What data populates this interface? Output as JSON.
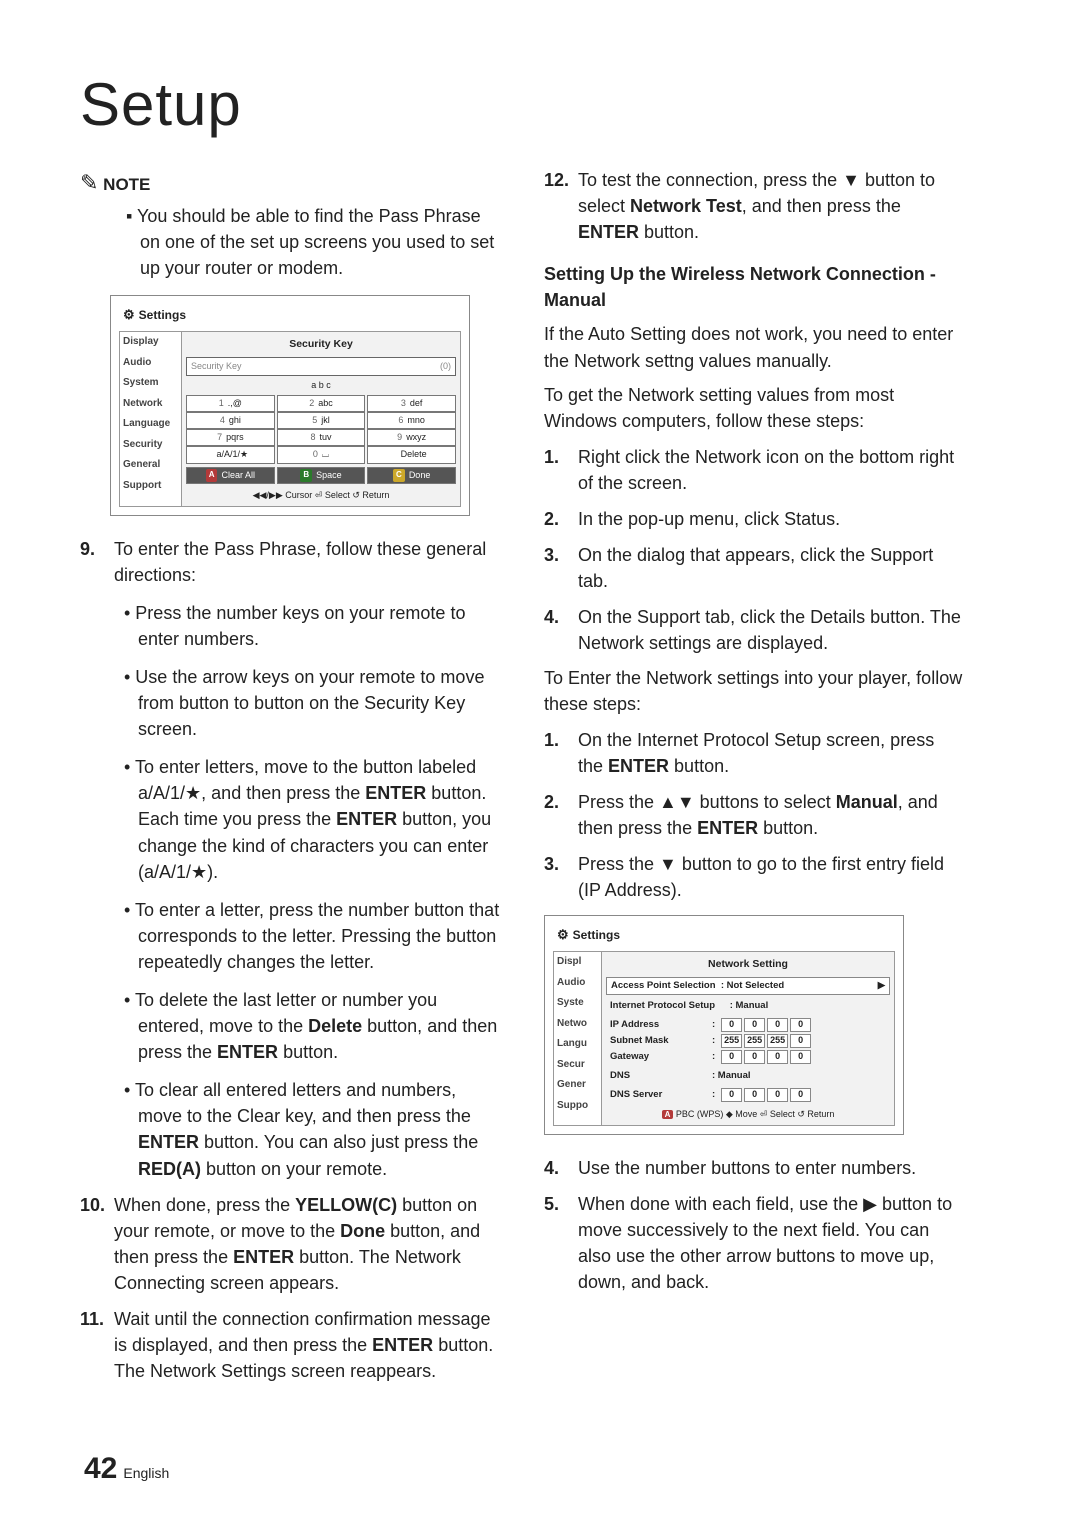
{
  "title": "Setup",
  "noteLabel": "NOTE",
  "noteBody": "▪ You should be able to find the Pass Phrase on one of the set up screens you used to set up your router or modem.",
  "shot1": {
    "settingsLabel": "Settings",
    "sidebar": [
      "Display",
      "Audio",
      "System",
      "Network",
      "Language",
      "Security",
      "General",
      "Support"
    ],
    "paneTitle": "Security Key",
    "inputPlaceholder": "Security Key",
    "inputCount": "(0)",
    "abc": "a  b  c",
    "keys": [
      [
        "1",
        ".,@",
        "2",
        "abc",
        "3",
        "def"
      ],
      [
        "4",
        "ghi",
        "5",
        "jkl",
        "6",
        "mno"
      ],
      [
        "7",
        "pqrs",
        "8",
        "tuv",
        "9",
        "wxyz"
      ],
      [
        "",
        "a/A/1/★",
        "0",
        "⌴",
        "",
        "Delete"
      ]
    ],
    "bottom": {
      "clear": "Clear All",
      "space": "Space",
      "done": "Done"
    },
    "hints": "◀◀/▶▶ Cursor   ⏎ Select   ↺ Return"
  },
  "left": {
    "step9": {
      "num": "9.",
      "text": "To enter the Pass Phrase, follow these general directions:"
    },
    "b1": "• Press the number keys on your remote to enter numbers.",
    "b2": "• Use the arrow keys on your remote to move from button to button on the Security Key screen.",
    "b3_pre": "• To enter letters, move to the button labeled a/A/1/★, and then press the ",
    "b3_mid": " button. Each time you press the ",
    "b3_post": " button, you change the kind of characters you can enter (a/A/1/★).",
    "b4": "• To enter a letter, press the number button that corresponds to the letter. Pressing the button repeatedly changes the letter.",
    "b5_pre": "• To delete the last letter or number you entered, move to the ",
    "b5_mid": " button, and then press the ",
    "b5_post": " button.",
    "b6_pre": "• To clear all entered letters and numbers, move to the Clear key, and then press the ",
    "b6_mid": " button. You can also just press the ",
    "b6_post": " button on your remote.",
    "step10": {
      "num": "10.",
      "pre": "When done, press the ",
      "mid": " button on your remote, or move to the ",
      "mid2": " button, and then press the ",
      "post": " button. The Network Connecting screen appears."
    },
    "step11": {
      "num": "11.",
      "pre": "Wait until the connection confirmation message is displayed, and then press the ",
      "post": " button. The Network Settings screen reappears."
    }
  },
  "right": {
    "step12": {
      "num": "12.",
      "pre": "To test the connection, press the ▼ button to select ",
      "mid": ", and then press the ",
      "post": " button."
    },
    "subhead": "Setting Up the Wireless Network Connection - Manual",
    "p1": "If the Auto Setting does not work, you need to enter the Network settng values manually.",
    "p2": "To get the Network setting values from most Windows computers, follow these steps:",
    "s1": {
      "num": "1.",
      "text": "Right click the Network icon on the bottom right of the screen."
    },
    "s2": {
      "num": "2.",
      "text": "In the pop-up menu, click Status."
    },
    "s3": {
      "num": "3.",
      "text": "On the dialog that appears, click the Support tab."
    },
    "s4": {
      "num": "4.",
      "text": "On the Support tab, click the Details button. The Network settings are displayed."
    },
    "p3": "To Enter the Network settings into your player, follow these steps:",
    "t1": {
      "num": "1.",
      "pre": "On the Internet Protocol Setup screen, press the ",
      "post": " button."
    },
    "t2": {
      "num": "2.",
      "pre": "Press the ▲▼ buttons to select ",
      "mid": ", and then press the ",
      "post": " button."
    },
    "t3": {
      "num": "3.",
      "text": "Press the ▼ button to go to the first entry field (IP Address)."
    },
    "u4": {
      "num": "4.",
      "text": "Use the number buttons to enter numbers."
    },
    "u5": {
      "num": "5.",
      "text": "When done with each field, use the ▶ button to move successively to the next field. You can also use the other arrow buttons to move up, down, and back."
    }
  },
  "shot2": {
    "settingsLabel": "Settings",
    "sidebar": [
      "Display",
      "Audio",
      "System",
      "Network",
      "Language",
      "Security",
      "General",
      "Support"
    ],
    "paneTitle": "Network Setting",
    "ap": {
      "label": "Access Point Selection",
      "value": ": Not Selected"
    },
    "ips": {
      "label": "Internet Protocol Setup",
      "value": ": Manual"
    },
    "rows": [
      {
        "label": "IP Address",
        "vals": [
          "0",
          "0",
          "0",
          "0"
        ]
      },
      {
        "label": "Subnet Mask",
        "vals": [
          "255",
          "255",
          "255",
          "0"
        ]
      },
      {
        "label": "Gateway",
        "vals": [
          "0",
          "0",
          "0",
          "0"
        ]
      }
    ],
    "dns": {
      "label": "DNS",
      "value": ": Manual"
    },
    "dnsserver": {
      "label": "DNS Server",
      "vals": [
        "0",
        "0",
        "0",
        "0"
      ]
    },
    "hints": " PBC (WPS)   ◆ Move   ⏎ Select   ↺ Return"
  },
  "words": {
    "enter": "ENTER",
    "delete": "Delete",
    "reda": "RED(A)",
    "yellowc": "YELLOW(C)",
    "done": "Done",
    "networktest": "Network Test",
    "manual": "Manual",
    "a": "A"
  },
  "footer": {
    "page": "42",
    "lang": "English"
  }
}
